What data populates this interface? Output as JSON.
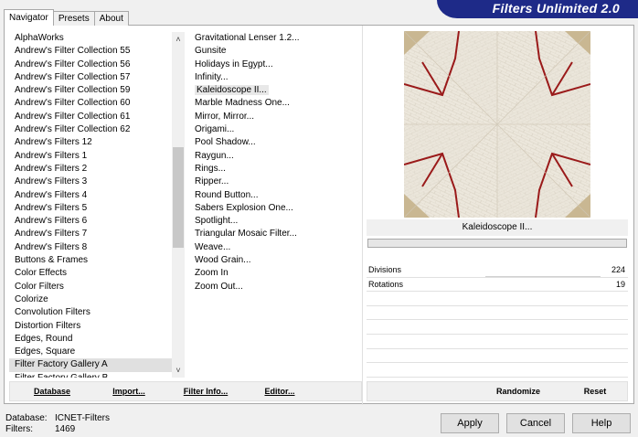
{
  "window": {
    "title": "Filters Unlimited 2.0",
    "banner_color": "#1e2a88"
  },
  "tabs": [
    {
      "label": "Navigator",
      "active": true
    },
    {
      "label": "Presets",
      "active": false
    },
    {
      "label": "About",
      "active": false
    }
  ],
  "categories": [
    "AlphaWorks",
    "Andrew's Filter Collection 55",
    "Andrew's Filter Collection 56",
    "Andrew's Filter Collection 57",
    "Andrew's Filter Collection 59",
    "Andrew's Filter Collection 60",
    "Andrew's Filter Collection 61",
    "Andrew's Filter Collection 62",
    "Andrew's Filters 12",
    "Andrew's Filters 1",
    "Andrew's Filters 2",
    "Andrew's Filters 3",
    "Andrew's Filters 4",
    "Andrew's Filters 5",
    "Andrew's Filters 6",
    "Andrew's Filters 7",
    "Andrew's Filters 8",
    "Buttons & Frames",
    "Color Effects",
    "Color Filters",
    "Colorize",
    "Convolution Filters",
    "Distortion Filters",
    "Edges, Round",
    "Edges, Square",
    "Filter Factory Gallery A",
    "Filter Factory Gallery B"
  ],
  "selected_category": "Filter Factory Gallery A",
  "filters": [
    "Gravitational Lenser 1.2...",
    "Gunsite",
    "Holidays in Egypt...",
    "Infinity...",
    "Kaleidoscope II...",
    "Marble Madness One...",
    "Mirror, Mirror...",
    "Origami...",
    "Pool Shadow...",
    "Raygun...",
    "Rings...",
    "Ripper...",
    "Round Button...",
    "Sabers Explosion One...",
    "Spotlight...",
    "Triangular Mosaic Filter...",
    "Weave...",
    "Wood Grain...",
    "Zoom In",
    "Zoom Out..."
  ],
  "selected_filter": "Kaleidoscope II...",
  "preview": {
    "filter_name": "Kaleidoscope II...",
    "base_color": "#e9e4d9",
    "line_color": "#9a1a1a"
  },
  "params": [
    {
      "label": "Divisions",
      "value": "224"
    },
    {
      "label": "Rotations",
      "value": "19"
    }
  ],
  "left_buttons": {
    "database": "Database",
    "import": "Import...",
    "filter_info": "Filter Info...",
    "editor": "Editor..."
  },
  "right_buttons": {
    "randomize": "Randomize",
    "reset": "Reset"
  },
  "status": {
    "database_label": "Database:",
    "database_value": "ICNET-Filters",
    "filters_label": "Filters:",
    "filters_value": "1469"
  },
  "dialog_buttons": {
    "apply": "Apply",
    "cancel": "Cancel",
    "help": "Help"
  }
}
